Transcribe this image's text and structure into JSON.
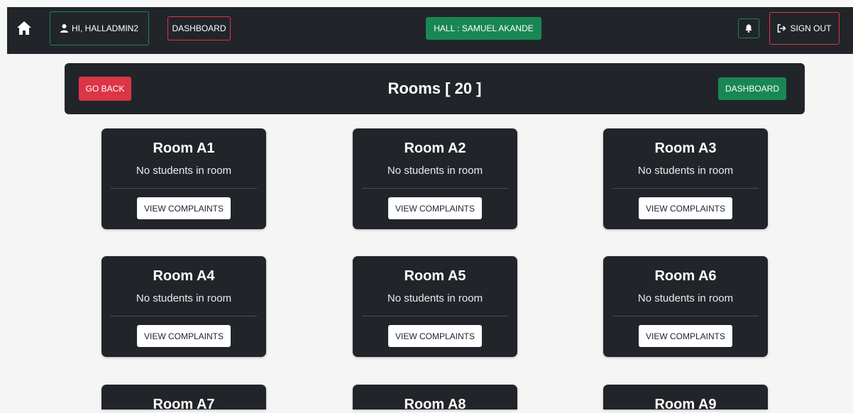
{
  "navbar": {
    "user_label": "HI, HALLADMIN2",
    "dashboard_label": "DASHBOARD",
    "hall_label": "HALL : SAMUEL AKANDE",
    "signout_label": "SIGN OUT"
  },
  "header": {
    "go_back_label": "GO BACK",
    "title": "Rooms [ 20 ]",
    "dashboard_label": "DASHBOARD"
  },
  "rooms": [
    {
      "name": "Room A1",
      "status": "No students in room",
      "button": "VIEW COMPLAINTS"
    },
    {
      "name": "Room A2",
      "status": "No students in room",
      "button": "VIEW COMPLAINTS"
    },
    {
      "name": "Room A3",
      "status": "No students in room",
      "button": "VIEW COMPLAINTS"
    },
    {
      "name": "Room A4",
      "status": "No students in room",
      "button": "VIEW COMPLAINTS"
    },
    {
      "name": "Room A5",
      "status": "No students in room",
      "button": "VIEW COMPLAINTS"
    },
    {
      "name": "Room A6",
      "status": "No students in room",
      "button": "VIEW COMPLAINTS"
    },
    {
      "name": "Room A7"
    },
    {
      "name": "Room A8"
    },
    {
      "name": "Room A9"
    }
  ],
  "colors": {
    "dark": "#212529",
    "success": "#198754",
    "danger": "#dc3545",
    "background": "#f5f5f5"
  },
  "icons": {
    "home": "home-icon",
    "user": "user-icon",
    "bell": "bell-icon",
    "signout": "sign-out-icon"
  }
}
